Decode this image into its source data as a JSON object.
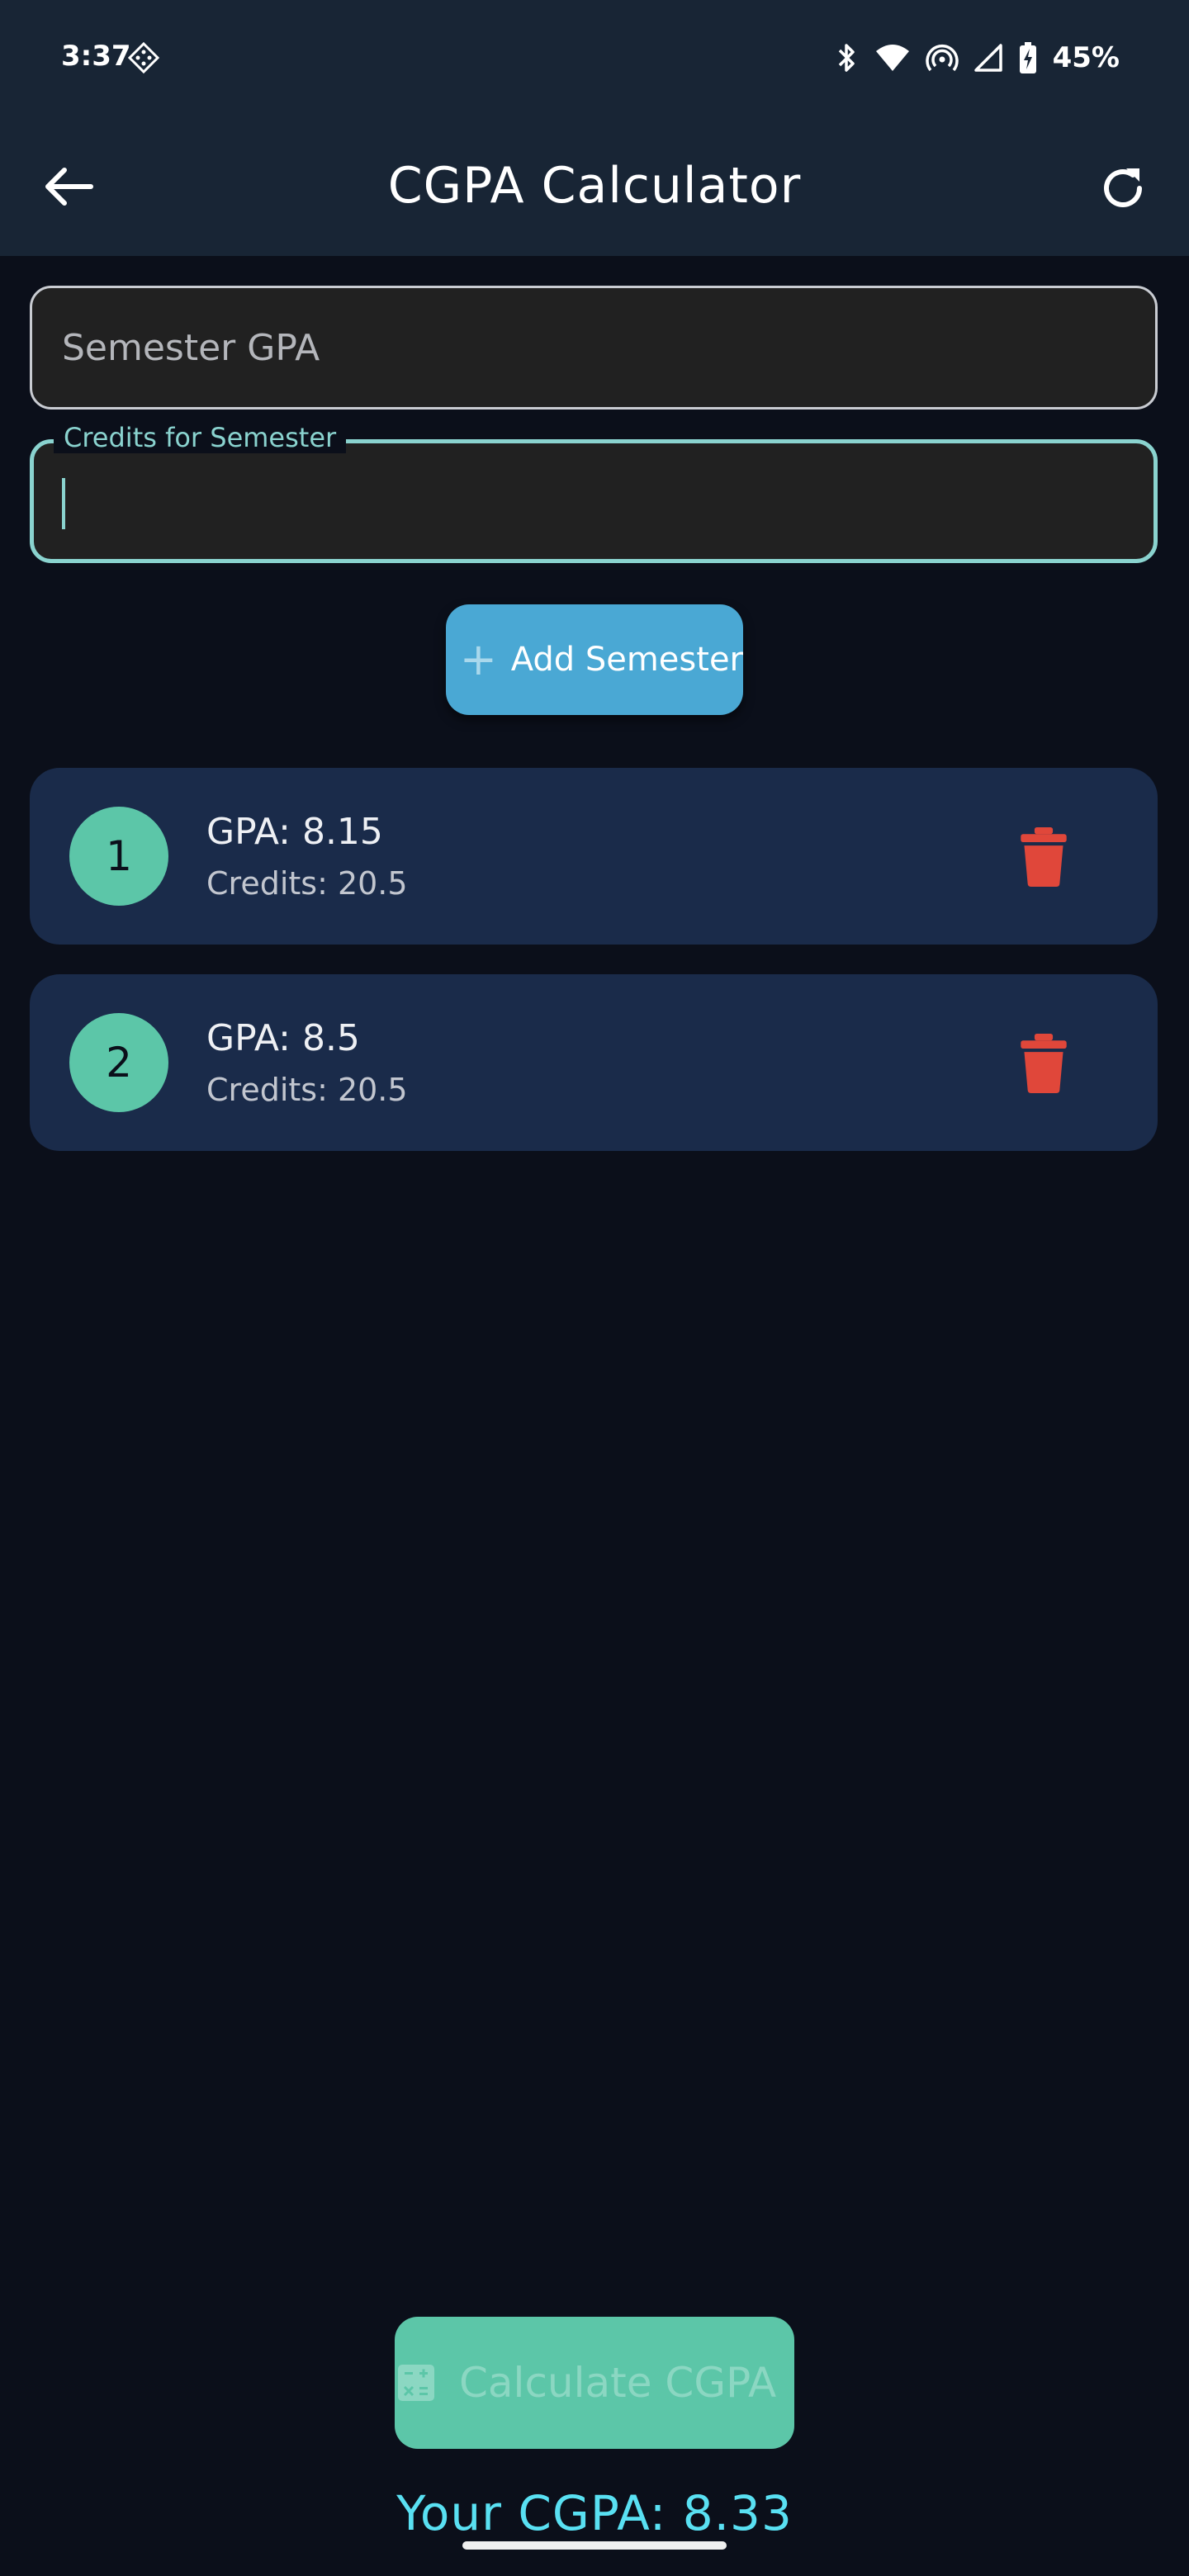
{
  "status_bar": {
    "time": "3:37",
    "battery": "45%",
    "icons": [
      "diamond-notification-icon",
      "bluetooth-icon",
      "wifi-icon",
      "hotspot-icon",
      "cellular-signal-icon",
      "battery-charging-icon"
    ]
  },
  "app_bar": {
    "title": "CGPA Calculator",
    "back_icon": "arrow-left-icon",
    "refresh_icon": "refresh-icon"
  },
  "form": {
    "gpa_placeholder": "Semester GPA",
    "gpa_value": "",
    "credits_label": "Credits for Semester",
    "credits_value": "",
    "add_button": {
      "icon": "plus-icon",
      "label": "Add Semester"
    }
  },
  "semesters": [
    {
      "number": "1",
      "gpa": "GPA: 8.15",
      "credits": "Credits: 20.5"
    },
    {
      "number": "2",
      "gpa": "GPA: 8.5",
      "credits": "Credits: 20.5"
    }
  ],
  "calculate_button": {
    "icon": "calculator-icon",
    "label": "Calculate CGPA"
  },
  "result": "Your CGPA: 8.33",
  "colors": {
    "background": "#0b0f1a",
    "app_bar": "#182535",
    "accent_teal": "#5cc6a8",
    "accent_blue": "#4aa8d4",
    "card": "#1a2b4a",
    "delete_red": "#e0473a",
    "result_cyan": "#59e0f2"
  }
}
